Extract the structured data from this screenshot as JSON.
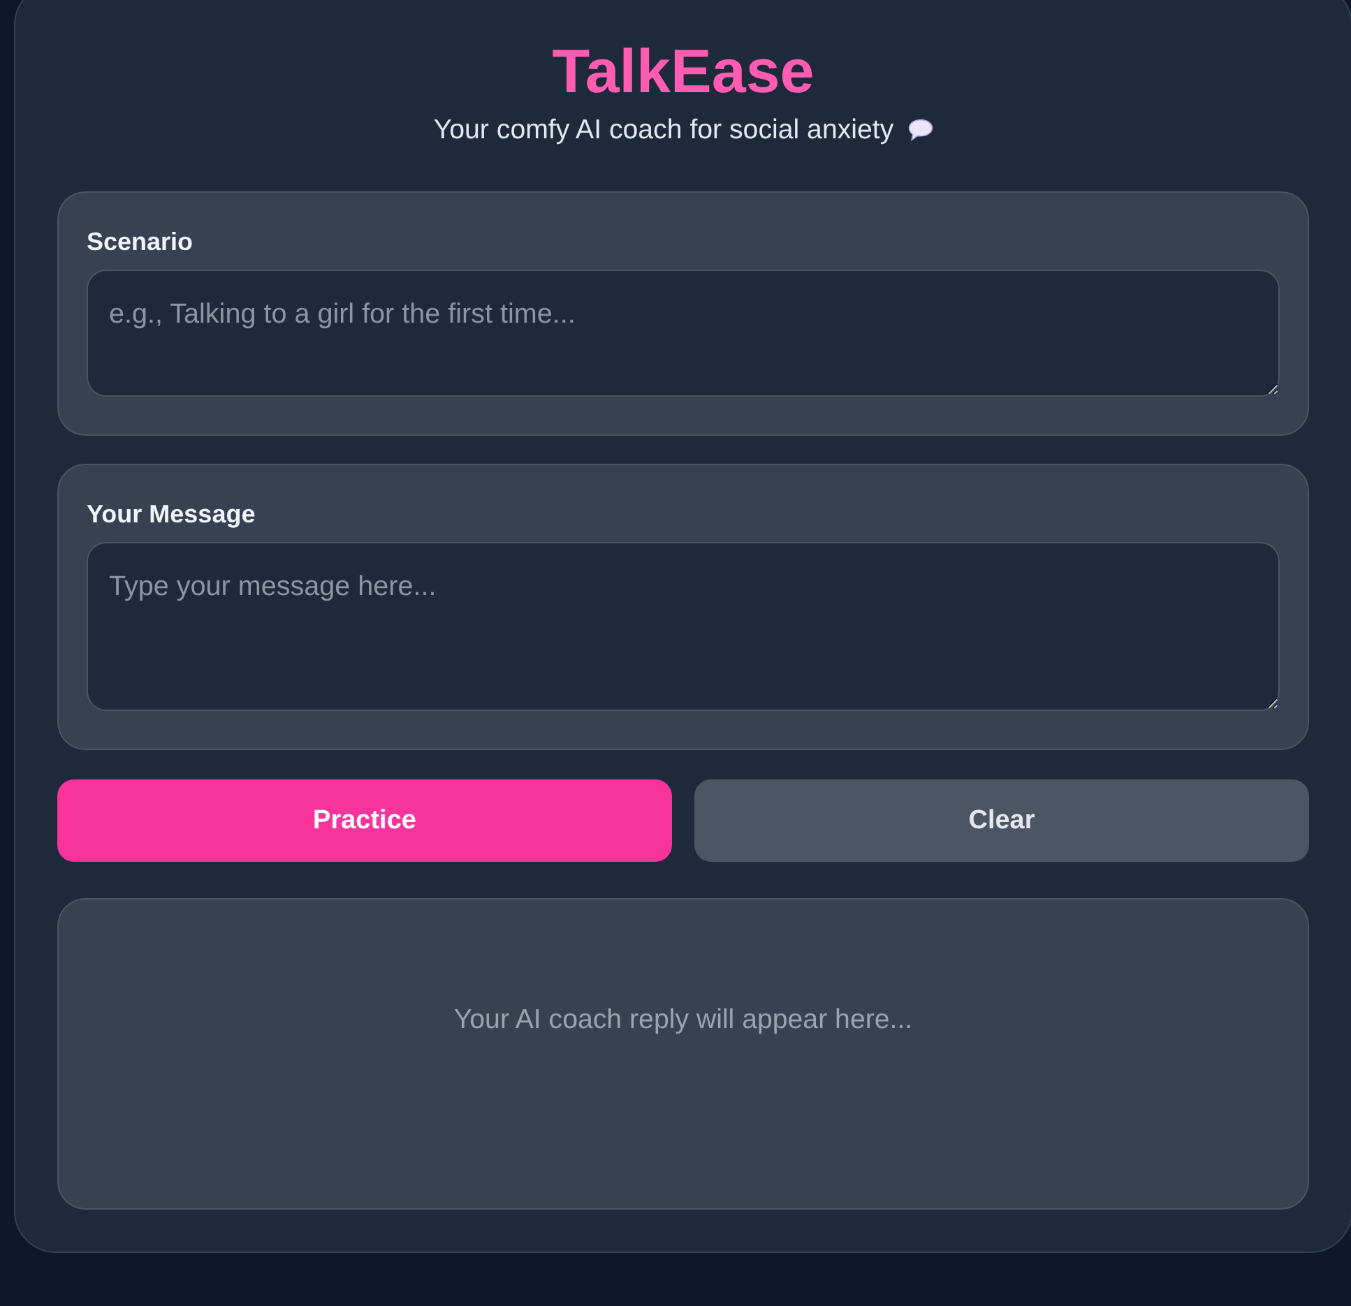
{
  "app": {
    "title": "TalkEase",
    "subtitle": "Your comfy AI coach for social anxiety"
  },
  "fields": [
    {
      "label": "Scenario",
      "placeholder": "e.g., Talking to a girl for the first time..."
    },
    {
      "label": "Your Message",
      "placeholder": "Type your message here..."
    }
  ],
  "buttons": [
    {
      "label": "Practice",
      "kind": "primary"
    },
    {
      "label": "Clear",
      "kind": "secondary"
    }
  ],
  "reply": {
    "empty_text": "Your AI coach reply will appear here..."
  }
}
